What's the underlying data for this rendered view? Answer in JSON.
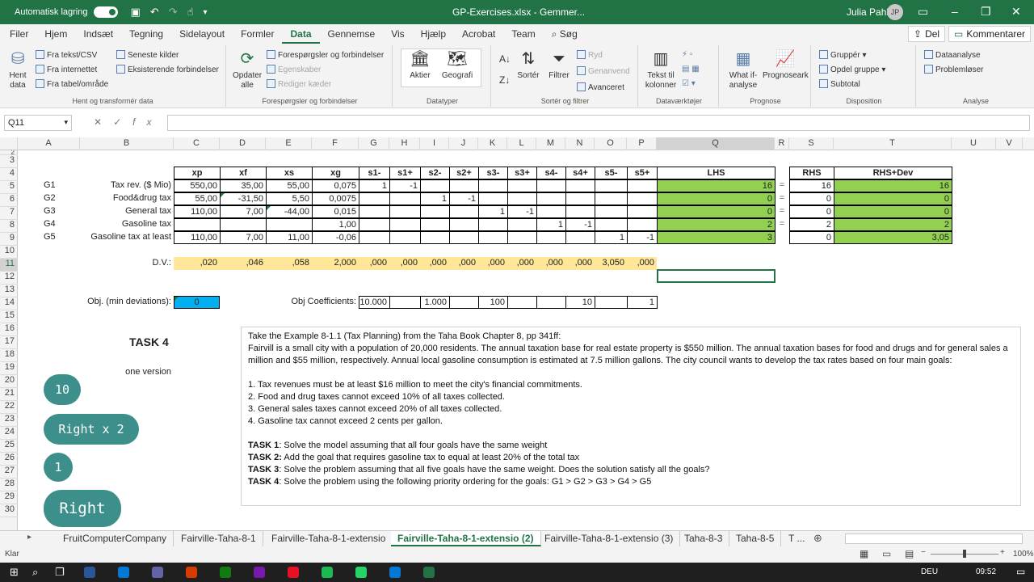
{
  "titlebar": {
    "autosave_label": "Automatisk lagring",
    "window_title": "GP-Exercises.xlsx - Gemmer...",
    "user_name": "Julia Pahl",
    "user_initials": "JP"
  },
  "menu": {
    "tabs": [
      "Filer",
      "Hjem",
      "Indsæt",
      "Tegning",
      "Sidelayout",
      "Formler",
      "Data",
      "Gennemse",
      "Vis",
      "Hjælp",
      "Acrobat",
      "Team",
      "Søg"
    ],
    "share": "Del",
    "comment": "Kommentarer"
  },
  "ribbon": {
    "get_data": "Hent data",
    "from_text": "Fra tekst/CSV",
    "from_web": "Fra internettet",
    "from_table": "Fra tabel/område",
    "recent": "Seneste kilder",
    "existing": "Eksisterende forbindelser",
    "group_get": "Hent og transformér data",
    "refresh": "Opdater alle",
    "queries": "Forespørgsler og forbindelser",
    "properties": "Egenskaber",
    "edit_links": "Rediger kæder",
    "group_queries": "Forespørgsler og forbindelser",
    "stocks": "Aktier",
    "geo": "Geografi",
    "group_types": "Datatyper",
    "sort": "Sortér",
    "filter": "Filtrer",
    "clear": "Ryd",
    "reapply": "Genanvend",
    "advanced": "Avanceret",
    "group_sort": "Sortér og filtrer",
    "text_to_cols": "Tekst til kolonner",
    "group_tools": "Dataværktøjer",
    "whatif": "What if-analyse",
    "forecast": "Prognoseark",
    "group_forecast": "Prognose",
    "group": "Gruppér",
    "ungroup": "Opdel gruppe",
    "subtotal": "Subtotal",
    "group_outline": "Disposition",
    "analysis": "Dataanalyse",
    "solver": "Problemløser",
    "group_analysis": "Analyse"
  },
  "formula": {
    "namebox": "Q11",
    "content": ""
  },
  "columns": [
    "A",
    "B",
    "C",
    "D",
    "E",
    "F",
    "G",
    "H",
    "I",
    "J",
    "K",
    "L",
    "M",
    "N",
    "O",
    "P",
    "Q",
    "R",
    "S",
    "T",
    "U",
    "V"
  ],
  "rows": [
    "2",
    "3",
    "4",
    "5",
    "6",
    "7",
    "8",
    "9",
    "10",
    "11",
    "12",
    "13",
    "14",
    "15",
    "16",
    "17",
    "18",
    "19",
    "20",
    "21",
    "22",
    "23",
    "24",
    "25",
    "26",
    "27",
    "28",
    "29",
    "30"
  ],
  "table": {
    "headers": [
      "xp",
      "xf",
      "xs",
      "xg",
      "s1-",
      "s1+",
      "s2-",
      "s2+",
      "s3-",
      "s3+",
      "s4-",
      "s4+",
      "s5-",
      "s5+",
      "LHS",
      "RHS",
      "RHS+Dev"
    ],
    "goals": [
      {
        "id": "G1",
        "label": "Tax rev. ($ Mio)",
        "vals": [
          "550,00",
          "35,00",
          "55,00",
          "0,075",
          "1",
          "-1",
          "",
          "",
          "",
          "",
          "",
          "",
          "",
          ""
        ],
        "lhs": "16",
        "rel": "=",
        "rhs": "16",
        "dev": "16"
      },
      {
        "id": "G2",
        "label": "Food&drug tax",
        "vals": [
          "55,00",
          "-31,50",
          "5,50",
          "0,0075",
          "",
          "",
          "1",
          "-1",
          "",
          "",
          "",
          "",
          "",
          ""
        ],
        "lhs": "0",
        "rel": "=",
        "rhs": "0",
        "dev": "0"
      },
      {
        "id": "G3",
        "label": "General tax",
        "vals": [
          "110,00",
          "7,00",
          "-44,00",
          "0,015",
          "",
          "",
          "",
          "",
          "1",
          "-1",
          "",
          "",
          "",
          ""
        ],
        "lhs": "0",
        "rel": "=",
        "rhs": "0",
        "dev": "0"
      },
      {
        "id": "G4",
        "label": "Gasoline tax",
        "vals": [
          "",
          "",
          "",
          "1,00",
          "",
          "",
          "",
          "",
          "",
          "",
          "1",
          "-1",
          "",
          ""
        ],
        "lhs": "2",
        "rel": "=",
        "rhs": "2",
        "dev": "2"
      },
      {
        "id": "G5",
        "label": "Gasoline tax at least",
        "vals": [
          "110,00",
          "7,00",
          "11,00",
          "-0,06",
          "",
          "",
          "",
          "",
          "",
          "",
          "",
          "",
          "1",
          "-1"
        ],
        "lhs": "3",
        "rel": "",
        "rhs": "0",
        "dev": "3,05"
      }
    ],
    "dv_label": "D.V.:",
    "dv_values": [
      ",020",
      ",046",
      ",058",
      "2,000",
      ",000",
      ",000",
      ",000",
      ",000",
      ",000",
      ",000",
      ",000",
      ",000",
      "3,050",
      ",000"
    ],
    "obj_label": "Obj. (min deviations):",
    "obj_value": "0",
    "coef_label": "Obj Coefficients:",
    "coef_values": [
      "10.000",
      "",
      "1.000",
      "",
      "100",
      "",
      "",
      "10",
      "",
      "1"
    ]
  },
  "task": {
    "title": "TASK 4",
    "subtitle": "one version"
  },
  "bubbles": [
    "10",
    "Right x 2",
    "1",
    "Right"
  ],
  "textbox": {
    "lines": [
      "Take the Example 8-1.1 (Tax Planning) from the Taha Book Chapter 8, pp 341ff:",
      "Fairvill is a small city with a population of 20,000 residents. The annual taxation base for real estate property is $550 million. The annual taxation bases for food and drugs and for general sales a",
      "million and $55 million, respectively. Annual local gasoline consumption is estimated at 7.5 million gallons. The city council wants to develop the tax rates based on four main goals:",
      "",
      "1. Tax revenues must be at least $16 million to meet the city's financial commitments.",
      "2. Food and drug taxes cannot exceed 10% of all taxes collected.",
      "3. General sales taxes cannot exceed 20% of all taxes collected.",
      "4. Gasoline tax cannot exceed 2 cents per gallon.",
      ""
    ],
    "tasks": [
      {
        "label": "TASK 1",
        "text": ": Solve the model assuming that all four goals have the same weight"
      },
      {
        "label": "TASK 2:",
        "text": " Add the goal that requires gasoline tax to equal at least 20% of the total tax"
      },
      {
        "label": "TASK 3",
        "text": ": Solve the problem assuming that all five goals have the same weight. Does the solution satisfy all the goals?"
      },
      {
        "label": "TASK 4",
        "text": ": Solve the problem using the following priority ordering for the goals: G1 > G2 > G3 > G4 > G5"
      }
    ]
  },
  "sheets": [
    "FruitComputerCompany",
    "Fairville-Taha-8-1",
    "Fairville-Taha-8-1-extensio",
    "Fairville-Taha-8-1-extensio (2)",
    "Fairville-Taha-8-1-extensio (3)",
    "Taha-8-3",
    "Taha-8-5",
    "T ..."
  ],
  "status": {
    "ready": "Klar",
    "zoom": "100%"
  },
  "taskbar": {
    "lang": "DEU",
    "time": "09:52"
  },
  "colors": {
    "excel_green": "#217346",
    "lhs_green": "#92d050",
    "dv_yellow": "#ffe699",
    "obj_blue": "#00b0f0",
    "bubble_teal": "#3d8f8c"
  }
}
